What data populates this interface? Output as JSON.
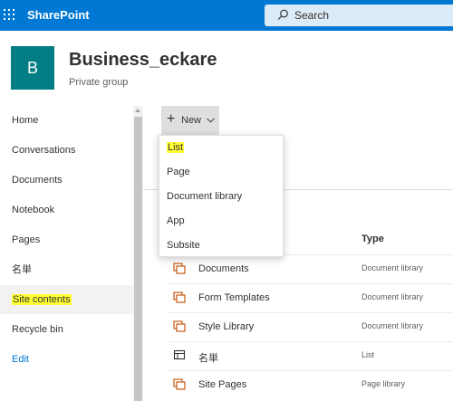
{
  "suitebar": {
    "brand": "SharePoint",
    "search_placeholder": "Search",
    "color": "#0078d4"
  },
  "site": {
    "logo_letter": "B",
    "title": "Business_eckare",
    "subtitle": "Private group",
    "logo_color": "#037d84"
  },
  "nav": {
    "items": [
      {
        "label": "Home"
      },
      {
        "label": "Conversations"
      },
      {
        "label": "Documents"
      },
      {
        "label": "Notebook"
      },
      {
        "label": "Pages"
      },
      {
        "label": "名単"
      },
      {
        "label": "Site contents",
        "selected": true,
        "highlighted": true
      },
      {
        "label": "Recycle bin"
      },
      {
        "label": "Edit"
      }
    ]
  },
  "command_bar": {
    "new_label": "New"
  },
  "new_menu": {
    "items": [
      {
        "label": "List",
        "highlighted": true
      },
      {
        "label": "Page"
      },
      {
        "label": "Document library"
      },
      {
        "label": "App"
      },
      {
        "label": "Subsite"
      }
    ]
  },
  "table": {
    "type_header": "Type",
    "rows": [
      {
        "name": "Documents",
        "type": "Document library",
        "icon": "document-library-icon"
      },
      {
        "name": "Form Templates",
        "type": "Document library",
        "icon": "document-library-icon"
      },
      {
        "name": "Style Library",
        "type": "Document library",
        "icon": "document-library-icon"
      },
      {
        "name": "名単",
        "type": "List",
        "icon": "list-icon"
      },
      {
        "name": "Site Pages",
        "type": "Page library",
        "icon": "page-library-icon"
      }
    ]
  },
  "highlight_color": "#ffff33"
}
